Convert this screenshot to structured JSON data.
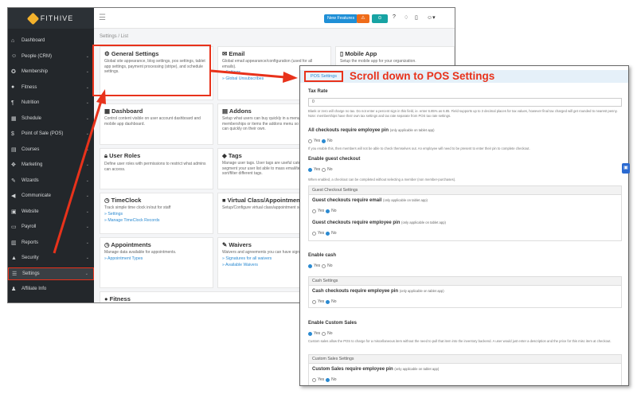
{
  "app": {
    "logo": "FITHIVE",
    "breadcrumb": "Settings / List"
  },
  "topbar": {
    "new_features": "New Features",
    "warn": "⚠",
    "teal": "⊙"
  },
  "sidebar": {
    "items": [
      {
        "label": "Dashboard",
        "icon": "dashboard-icon",
        "glyph": "⌂"
      },
      {
        "label": "People (CRM)",
        "icon": "people-icon",
        "glyph": "☺"
      },
      {
        "label": "Membership",
        "icon": "membership-icon",
        "glyph": "✪"
      },
      {
        "label": "Fitness",
        "icon": "fitness-icon",
        "glyph": "●"
      },
      {
        "label": "Nutrition",
        "icon": "nutrition-icon",
        "glyph": "¶"
      },
      {
        "label": "Schedule",
        "icon": "schedule-icon",
        "glyph": "▦"
      },
      {
        "label": "Point of Sale (POS)",
        "icon": "pos-icon",
        "glyph": "$"
      },
      {
        "label": "Courses",
        "icon": "courses-icon",
        "glyph": "▤"
      },
      {
        "label": "Marketing",
        "icon": "marketing-icon",
        "glyph": "✥"
      },
      {
        "label": "Wizards",
        "icon": "wizards-icon",
        "glyph": "✎"
      },
      {
        "label": "Communicate",
        "icon": "communicate-icon",
        "glyph": "◀"
      },
      {
        "label": "Website",
        "icon": "website-icon",
        "glyph": "▣"
      },
      {
        "label": "Payroll",
        "icon": "payroll-icon",
        "glyph": "▭"
      },
      {
        "label": "Reports",
        "icon": "reports-icon",
        "glyph": "▥"
      },
      {
        "label": "Security",
        "icon": "security-icon",
        "glyph": "▲"
      },
      {
        "label": "Settings",
        "icon": "settings-icon",
        "glyph": "☰"
      },
      {
        "label": "Affiliate Info",
        "icon": "affiliate-icon",
        "glyph": "♟"
      }
    ]
  },
  "cards": {
    "general": {
      "title": "General Settings",
      "desc": "Global site appearance, blog settings, pos settings, tablet app settings, payment processing (stripe), and schedule settings."
    },
    "email": {
      "title": "Email",
      "desc": "Global email appearance/configuration (used for all emails).",
      "links": [
        "» Settings",
        "» Global Unsubscribes"
      ]
    },
    "mobile": {
      "title": "Mobile App",
      "desc": "Setup the mobile app for your organization."
    },
    "dashboard": {
      "title": "Dashboard",
      "desc": "Control content visible on user account dashboard and mobile app dashboard."
    },
    "addons": {
      "title": "Addons",
      "desc": "Setup what users can buy quickly in a menu. You can add memberships or items the addons menu so that members can quickly on their own."
    },
    "roles": {
      "title": "User Roles",
      "desc": "Define user roles with permissions to restrict what admins can access."
    },
    "tags": {
      "title": "Tags",
      "desc": "Manage user tags. User tags are useful categorize and segment your user list able to mass email/text and sort/filter different tags."
    },
    "timeclock": {
      "title": "TimeClock",
      "desc": "Track simple time clock in/out for staff",
      "links": [
        "» Settings",
        "» Manage TimeClock Records"
      ]
    },
    "virtual": {
      "title": "Virtual Class/Appointment",
      "desc": "Setup/Configure virtual class/appointment settings."
    },
    "appointments": {
      "title": "Appointments",
      "desc": "Manage data available for appointments.",
      "links": [
        "» Appointment Types"
      ]
    },
    "waivers": {
      "title": "Waivers",
      "desc": "Waivers and agreements you can have sign.",
      "links": [
        "» Signatures for all waivers",
        "» Available Waivers"
      ]
    },
    "fitness": {
      "title": "Fitness"
    }
  },
  "overlay": {
    "tab": "POS Settings",
    "tip": "Scroll down to POS Settings",
    "tax_rate": {
      "label": "Tax Rate",
      "value": "0",
      "help": "Blank or zero will charge no tax. Do not enter a percent sign in this field, ie. enter 6.85% as 6.85. Field supports up to 3 decimal places for tax values, however final tax charged will get rounded to nearest penny. Note: memberships have their own tax settings and tax rate separate from POS tax rate settings."
    },
    "emp_pin": {
      "label": "All checkouts require employee pin",
      "note": "(only applicable on tablet app)",
      "help": "If you enable this, then members will not be able to check themselves out. An employee will need to be present to enter their pin to complete checkout."
    },
    "guest": {
      "label": "Enable guest checkout",
      "help": "When enabled, a checkout can be completed without selecting a member (non member-purchases).",
      "panel": "Guest Checkout Settings",
      "email_label": "Guest checkouts require email",
      "pin_label": "Guest checkouts require employee pin"
    },
    "cash": {
      "label": "Enable cash",
      "panel": "Cash Settings",
      "pin_label": "Cash checkouts require employee pin"
    },
    "custom": {
      "label": "Enable Custom Sales",
      "help": "Custom sales allow the POS to charge for a miscellaneous item without the need to pull that item into the inventory backend. A user would just enter a description and the price for this misc item at checkout.",
      "panel": "Custom Sales Settings",
      "pin_label": "Custom Sales require employee pin"
    },
    "tablet_note": "(only applicable on tablet app)",
    "yes": "Yes",
    "no": "No"
  },
  "colors": {
    "accent": "#e8321b",
    "link": "#2b8ad1",
    "sidebar": "#23272b"
  }
}
